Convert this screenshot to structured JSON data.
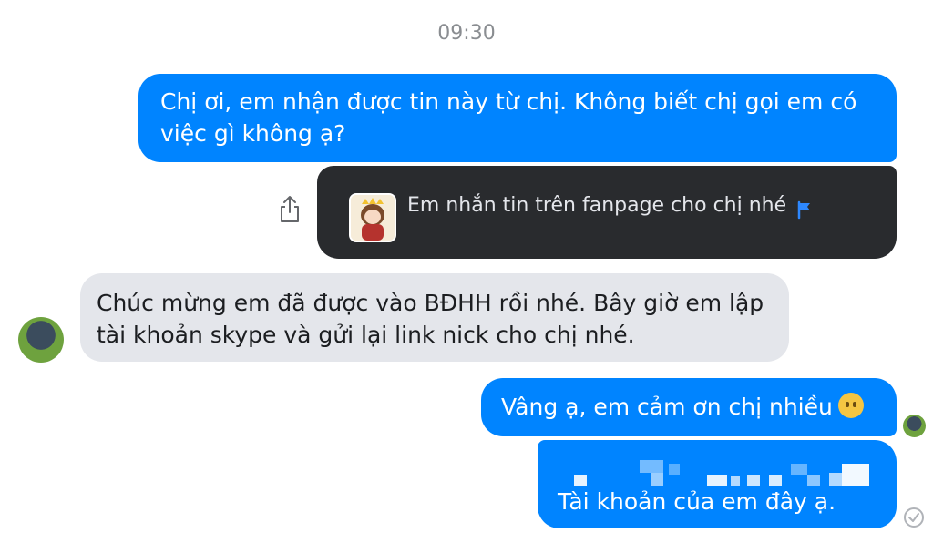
{
  "conversation": {
    "timestamp": "09:30",
    "messages": [
      {
        "from": "me",
        "text": "Chị ơi, em nhận được tin này từ chị. Không biết chị gọi em có việc gì không ạ?"
      },
      {
        "from": "me",
        "type": "reply-card",
        "text": "Em nhắn tin trên fanpage cho chị nhé"
      },
      {
        "from": "contact",
        "text": "Chúc mừng em đã được vào BĐHH rồi nhé. Bây giờ em lập tài khoản skype và gửi lại link nick cho chị nhé."
      },
      {
        "from": "me",
        "text": "Vâng ạ, em cảm ơn chị nhiều"
      },
      {
        "from": "me",
        "text": "Tài khoản của em đây ạ."
      }
    ]
  },
  "icons": {
    "share": "share-icon",
    "flag": "flag-icon",
    "emoji": "smile-emoji-icon",
    "sent": "sent-check-icon"
  },
  "colors": {
    "outgoing_bubble": "#0084ff",
    "incoming_bubble": "#e4e6eb",
    "reply_card": "#292b2e",
    "timestamp": "#8a8d91"
  }
}
